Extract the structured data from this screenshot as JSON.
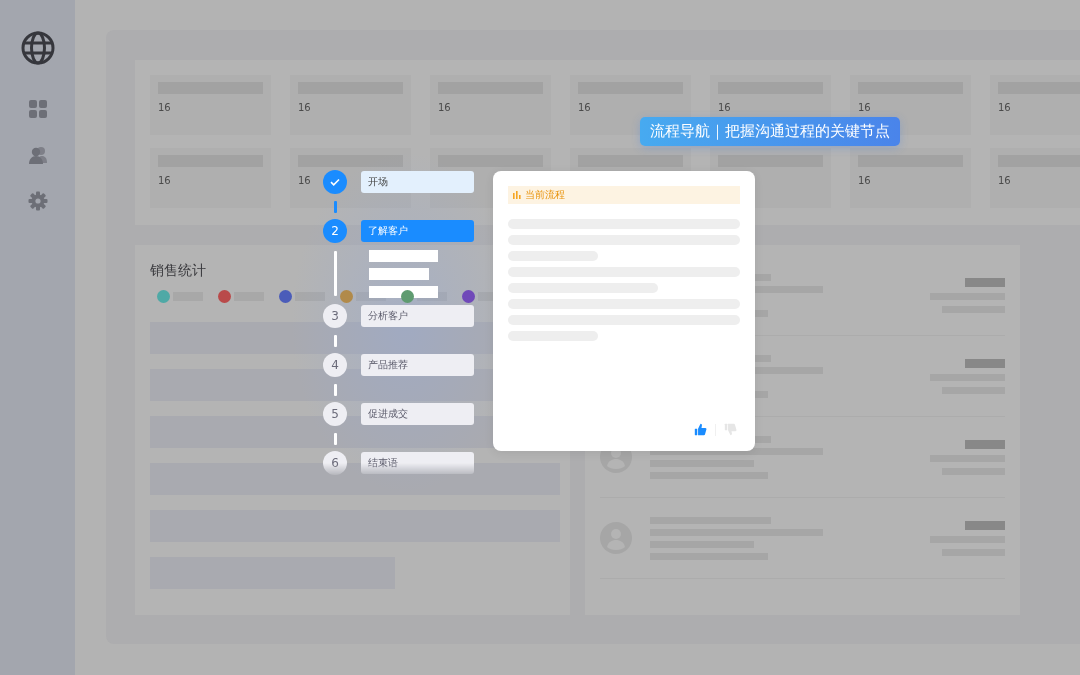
{
  "sidebar": {
    "items": [
      {
        "kind": "globe",
        "selected": true
      },
      {
        "kind": "grid",
        "selected": false
      },
      {
        "kind": "users",
        "selected": false
      },
      {
        "kind": "settings",
        "selected": false
      }
    ]
  },
  "stat_cards": [
    [
      {
        "kind": "value",
        "value": "16"
      },
      {
        "kind": "value",
        "value": "16"
      },
      {
        "kind": "value",
        "value": "16"
      },
      {
        "kind": "value",
        "value": "16"
      },
      {
        "kind": "value",
        "value": "16"
      },
      {
        "kind": "value",
        "value": "16"
      },
      {
        "kind": "value",
        "value": "16"
      }
    ],
    [
      {
        "kind": "value",
        "value": "16"
      },
      {
        "kind": "value",
        "value": "16"
      },
      {
        "kind": "blank"
      },
      {
        "kind": "blank"
      },
      {
        "kind": "blank"
      },
      {
        "kind": "value",
        "value": "16"
      },
      {
        "kind": "value",
        "value": "16"
      }
    ]
  ],
  "sales_panel": {
    "title": "销售统计",
    "legend": [
      {
        "color": "#4fa9a6"
      },
      {
        "color": "#b94a4a"
      },
      {
        "color": "#4b5cb9"
      },
      {
        "color": "#b18a4a"
      },
      {
        "color": "#5f9b70"
      },
      {
        "color": "#7049b9"
      }
    ]
  },
  "banner": {
    "text": "流程导航｜把握沟通过程的关键节点"
  },
  "steps": [
    {
      "label": "开场",
      "kind": "done"
    },
    {
      "number": "2",
      "label": "了解客户",
      "kind": "current"
    },
    {
      "number": "3",
      "label": "分析客户",
      "kind": "pending"
    },
    {
      "number": "4",
      "label": "产品推荐",
      "kind": "pending"
    },
    {
      "number": "5",
      "label": "促进成交",
      "kind": "pending"
    },
    {
      "number": "6",
      "label": "结束语",
      "kind": "pending"
    }
  ],
  "detail_card": {
    "header": "当前流程",
    "feedback": {
      "liked": true
    }
  }
}
